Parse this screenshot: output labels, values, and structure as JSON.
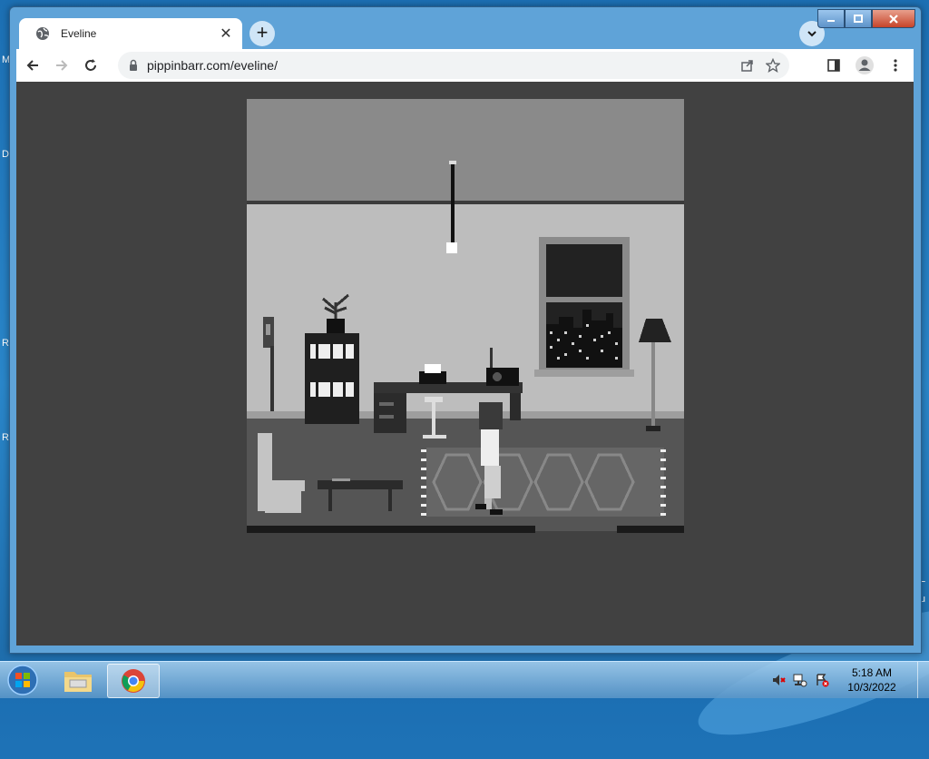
{
  "desktop": {
    "edge_labels_left": [
      "M",
      "D",
      "R",
      "R"
    ],
    "edge_labels_right": [
      "L",
      "u"
    ]
  },
  "browser": {
    "tab": {
      "title": "Eveline",
      "favicon": "globe-icon"
    },
    "new_tab_label": "+",
    "address": {
      "url": "pippinbarr.com/eveline/"
    },
    "accent": "#5fa3d8"
  },
  "game": {
    "title": "Eveline",
    "palette": [
      "#8a8a8a",
      "#bdbdbd",
      "#555555",
      "#2b2b2b",
      "#ffffff"
    ]
  },
  "taskbar": {
    "apps": [
      "file-explorer",
      "google-chrome"
    ],
    "clock": {
      "time": "5:18 AM",
      "date": "10/3/2022"
    }
  }
}
